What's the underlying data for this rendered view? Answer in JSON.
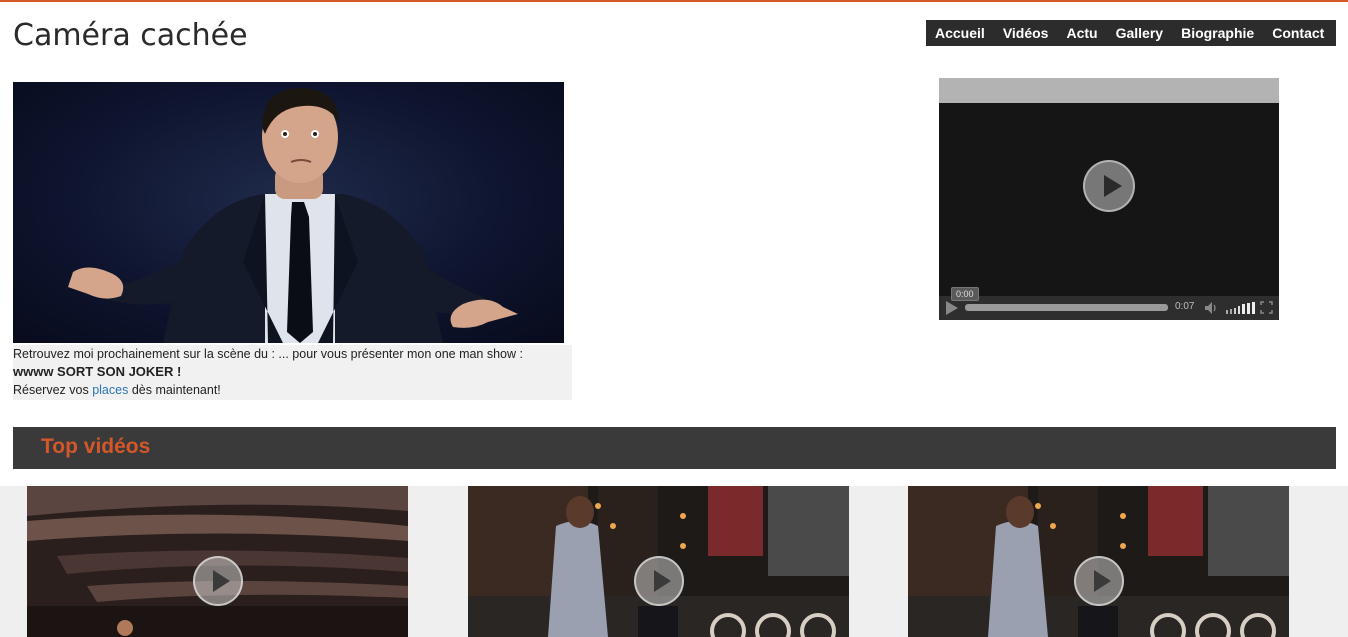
{
  "site": {
    "title": "Caméra cachée"
  },
  "nav": {
    "items": [
      {
        "label": "Accueil"
      },
      {
        "label": "Vidéos"
      },
      {
        "label": "Actu"
      },
      {
        "label": "Gallery"
      },
      {
        "label": "Biographie"
      },
      {
        "label": "Contact"
      }
    ]
  },
  "hero": {
    "caption_line1": "Retrouvez moi prochainement sur la scène du : ... pour vous présenter mon one man show :",
    "caption_line2": "wwww SORT SON JOKER !",
    "caption_line3_before": "Réservez vos ",
    "caption_link": "places",
    "caption_line3_after": " dès maintenant!"
  },
  "player": {
    "tooltip_time": "0:00",
    "duration": "0:07",
    "icons": [
      "play-icon",
      "volume-icon",
      "volume-level-icon",
      "fullscreen-icon"
    ]
  },
  "top_videos": {
    "heading": "Top vidéos"
  },
  "colors": {
    "accent": "#d4572a",
    "nav_bg": "#2c2c2c",
    "section_bar_bg": "#3a3a3a",
    "link": "#2a74b5"
  }
}
